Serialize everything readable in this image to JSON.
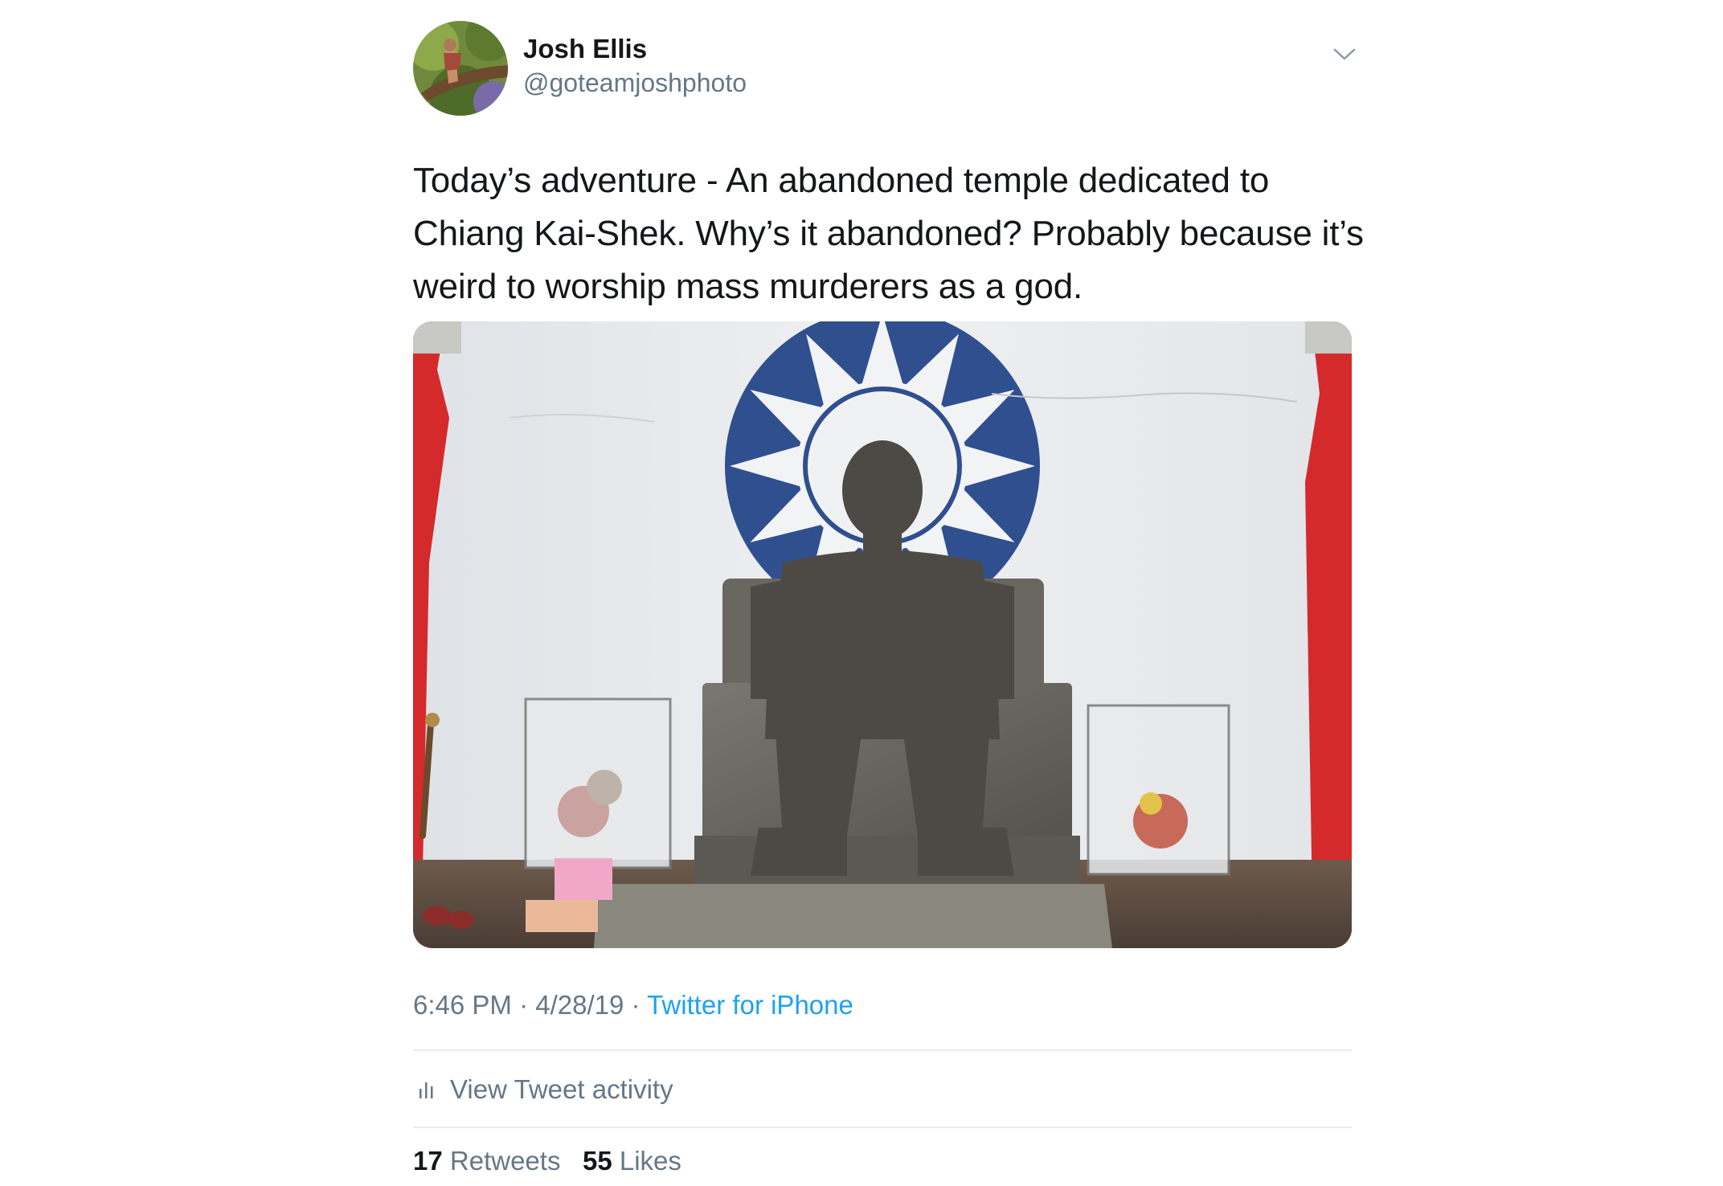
{
  "author": {
    "name": "Josh Ellis",
    "handle": "@goteamjoshphoto"
  },
  "tweet": {
    "text_lines": [
      "Today’s adventure - An abandoned temple dedicated to",
      "Chiang Kai-Shek. Why’s it abandoned? Probably because it’s",
      "weird to worship mass murderers as a god."
    ],
    "time": "6:46 PM",
    "separator": " · ",
    "date": "4/28/19",
    "source": "Twitter for iPhone"
  },
  "activity": {
    "label": "View Tweet activity",
    "icon": "bar-chart-icon"
  },
  "stats": {
    "retweets_count": "17",
    "retweets_label": "Retweets",
    "likes_count": "55",
    "likes_label": "Likes"
  },
  "menu_icon": "chevron-down-icon",
  "colors": {
    "link": "#1da1f2",
    "secondary_text": "#657786",
    "primary_text": "#14171a",
    "divider": "#e6ecf0",
    "emblem_blue": "#2f4f8f",
    "curtain_red": "#d42a2c"
  }
}
